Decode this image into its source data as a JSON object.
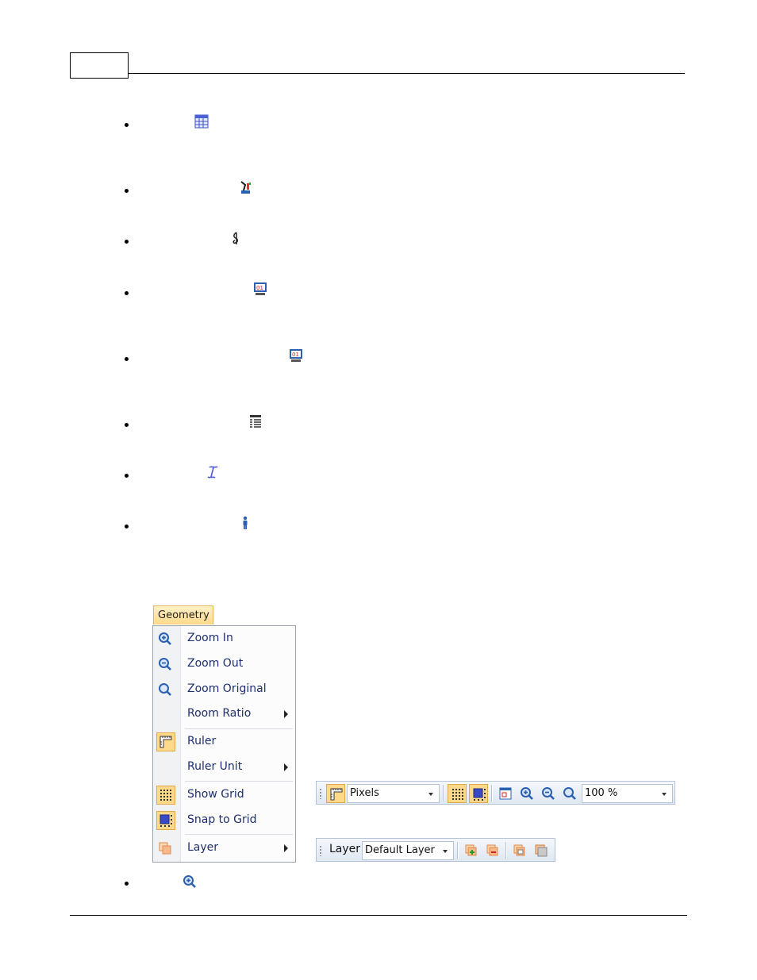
{
  "colors": {
    "menu_text": "#1e2f6b",
    "highlight_fill": "#ffd98a",
    "highlight_border": "#e3a84a",
    "toolbar_border": "#b6c4d8",
    "icon_blue": "#2b5fb0"
  },
  "bullet_icons": [
    "table-grid-icon",
    "robot-arm-icon",
    "music-note-icon",
    "binary-monitor-icon",
    "binary-monitor-icon",
    "list-icon",
    "italic-formula-icon",
    "person-icon",
    "zoom-in-icon"
  ],
  "geometry_menu": {
    "tab_label": "Geometry",
    "items": {
      "zoom_in": "Zoom In",
      "zoom_out": "Zoom Out",
      "zoom_original": "Zoom Original",
      "room_ratio": "Room Ratio",
      "ruler": "Ruler",
      "ruler_unit": "Ruler Unit",
      "show_grid": "Show Grid",
      "snap_to_grid": "Snap to Grid",
      "layer": "Layer"
    }
  },
  "geometry_toolbar": {
    "unit_value": "Pixels",
    "zoom_value": "100 %"
  },
  "layer_toolbar": {
    "label": "Layer",
    "layer_value": "Default Layer"
  }
}
